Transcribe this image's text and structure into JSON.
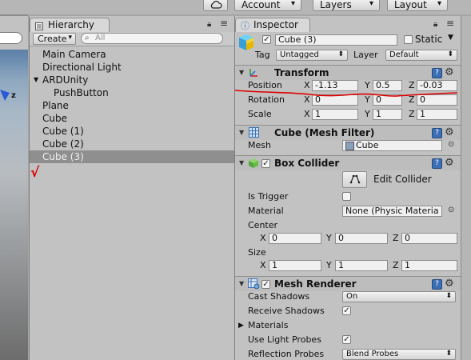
{
  "toolbar": {
    "cloud_icon": "cloud-icon",
    "account": "Account",
    "layers": "Layers",
    "layout": "Layout"
  },
  "hierarchy": {
    "tab": "Hierarchy",
    "create": "Create",
    "search_placeholder": "All",
    "items": [
      {
        "label": "Main Camera",
        "indent": 0,
        "foldout": false,
        "selected": false
      },
      {
        "label": "Directional Light",
        "indent": 0,
        "foldout": false,
        "selected": false
      },
      {
        "label": "ARDUnity",
        "indent": 0,
        "foldout": true,
        "selected": false
      },
      {
        "label": "PushButton",
        "indent": 1,
        "foldout": false,
        "selected": false
      },
      {
        "label": "Plane",
        "indent": 0,
        "foldout": false,
        "selected": false
      },
      {
        "label": "Cube",
        "indent": 0,
        "foldout": false,
        "selected": false
      },
      {
        "label": "Cube (1)",
        "indent": 0,
        "foldout": false,
        "selected": false
      },
      {
        "label": "Cube (2)",
        "indent": 0,
        "foldout": false,
        "selected": false
      },
      {
        "label": "Cube (3)",
        "indent": 0,
        "foldout": false,
        "selected": true
      }
    ]
  },
  "scene": {
    "axis_label": "z"
  },
  "inspector": {
    "tab": "Inspector",
    "object_name": "Cube (3)",
    "static_label": "Static",
    "tag_label": "Tag",
    "tag_value": "Untagged",
    "layer_label": "Layer",
    "layer_value": "Default",
    "transform": {
      "title": "Transform",
      "position_label": "Position",
      "rotation_label": "Rotation",
      "scale_label": "Scale",
      "position": {
        "x": "-1.13",
        "y": "0.5",
        "z": "-0.03"
      },
      "rotation": {
        "x": "0",
        "y": "0",
        "z": "0"
      },
      "scale": {
        "x": "1",
        "y": "1",
        "z": "1"
      }
    },
    "mesh_filter": {
      "title": "Cube (Mesh Filter)",
      "mesh_label": "Mesh",
      "mesh_value": "Cube"
    },
    "box_collider": {
      "title": "Box Collider",
      "edit_collider": "Edit Collider",
      "is_trigger_label": "Is Trigger",
      "material_label": "Material",
      "material_value": "None (Physic Materia",
      "center_label": "Center",
      "size_label": "Size",
      "center": {
        "x": "0",
        "y": "0",
        "z": "0"
      },
      "size": {
        "x": "1",
        "y": "1",
        "z": "1"
      }
    },
    "mesh_renderer": {
      "title": "Mesh Renderer",
      "cast_shadows_label": "Cast Shadows",
      "cast_shadows_value": "On",
      "receive_shadows_label": "Receive Shadows",
      "materials_label": "Materials",
      "use_light_probes_label": "Use Light Probes",
      "reflection_probes_label": "Reflection Probes",
      "reflection_probes_value": "Blend Probes"
    },
    "axis": {
      "x": "X",
      "y": "Y",
      "z": "Z"
    }
  },
  "colors": {
    "panel_bg": "#c2c2c2",
    "selection_bg": "#8f8f8f",
    "annotation_red": "#dd0000"
  }
}
